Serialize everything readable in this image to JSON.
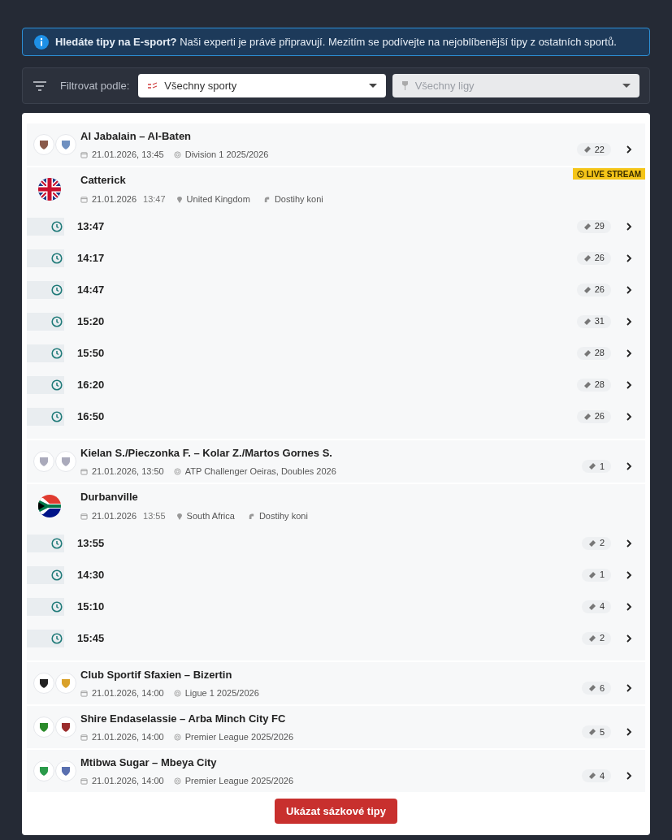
{
  "banner": {
    "text": "**Hledáte tipy na E-sport?** Naši experti je právě připravují. Mezitím se podívejte na nejoblíbenější tipy z ostatních sportů."
  },
  "filter": {
    "label": "Filtrovat podle:",
    "sport": {
      "value": "Všechny sporty",
      "disabled": false
    },
    "league": {
      "value": "Všechny ligy",
      "disabled": true
    }
  },
  "events": [
    {
      "kind": "match",
      "title": "Al Jabalain – Al-Baten",
      "datetime": "21.01.2026, 13:45",
      "league": "Division 1 2025/2026",
      "tips": "22"
    },
    {
      "kind": "race",
      "flag": {
        "kind": "gb"
      },
      "name": "Catterick",
      "date": "21.01.2026",
      "time": "13:47",
      "country": "United Kingdom",
      "sport": "Dostihy koni",
      "badge": "LIVE STREAM",
      "runs": [
        {
          "time": "13:47",
          "tips": "29"
        },
        {
          "time": "14:17",
          "tips": "26"
        },
        {
          "time": "14:47",
          "tips": "26"
        },
        {
          "time": "15:20",
          "tips": "31"
        },
        {
          "time": "15:50",
          "tips": "28"
        },
        {
          "time": "16:20",
          "tips": "28"
        },
        {
          "time": "16:50",
          "tips": "26"
        }
      ]
    },
    {
      "kind": "match",
      "title": "Kielan S./Pieczonka F. – Kolar Z./Martos Gornes S.",
      "datetime": "21.01.2026, 13:50",
      "league": "ATP Challenger Oeiras, Doubles 2026",
      "tips": "1"
    },
    {
      "kind": "race",
      "flag": {
        "kind": "za"
      },
      "name": "Durbanville",
      "date": "21.01.2026",
      "time": "13:55",
      "country": "South Africa",
      "sport": "Dostihy koni",
      "runs": [
        {
          "time": "13:55",
          "tips": "2"
        },
        {
          "time": "14:30",
          "tips": "1"
        },
        {
          "time": "15:10",
          "tips": "4"
        },
        {
          "time": "15:45",
          "tips": "2"
        }
      ]
    },
    {
      "kind": "match",
      "title": "Club Sportif Sfaxien – Bizertin",
      "datetime": "21.01.2026, 14:00",
      "league": "Ligue 1 2025/2026",
      "tips": "6"
    },
    {
      "kind": "match",
      "title": "Shire Endaselassie – Arba Minch City FC",
      "datetime": "21.01.2026, 14:00",
      "league": "Premier League 2025/2026",
      "tips": "5"
    },
    {
      "kind": "match",
      "title": "Mtibwa Sugar – Mbeya City",
      "datetime": "21.01.2026, 14:00",
      "league": "Premier League 2025/2026",
      "tips": "4"
    }
  ],
  "button": "Ukázat sázkové tipy"
}
